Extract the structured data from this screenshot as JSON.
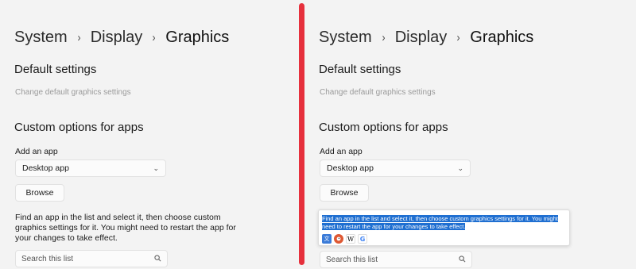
{
  "breadcrumb": {
    "items": [
      "System",
      "Display",
      "Graphics"
    ],
    "separator": "›"
  },
  "default_settings": {
    "heading": "Default settings",
    "link": "Change default graphics settings"
  },
  "custom_options": {
    "heading": "Custom options for apps",
    "add_label": "Add an app",
    "dropdown_value": "Desktop app",
    "browse_label": "Browse",
    "description": "Find an app in the list and select it, then choose custom graphics settings for it. You might need to restart the app for your changes to take effect.",
    "search_placeholder": "Search this list"
  },
  "selection_popup": {
    "selected_text": "Find an app in the list and select it, then choose custom graphics settings for it. You might need to restart the app for your changes to take effect.",
    "icons": [
      "translate-icon",
      "duckduckgo-icon",
      "wikipedia-icon",
      "google-icon"
    ],
    "wiki_glyph": "W",
    "google_glyph": "G",
    "translate_glyph": "文"
  },
  "colors": {
    "background": "#f3f3f3",
    "divider": "#e6303c",
    "selection": "#1f6fd1"
  }
}
